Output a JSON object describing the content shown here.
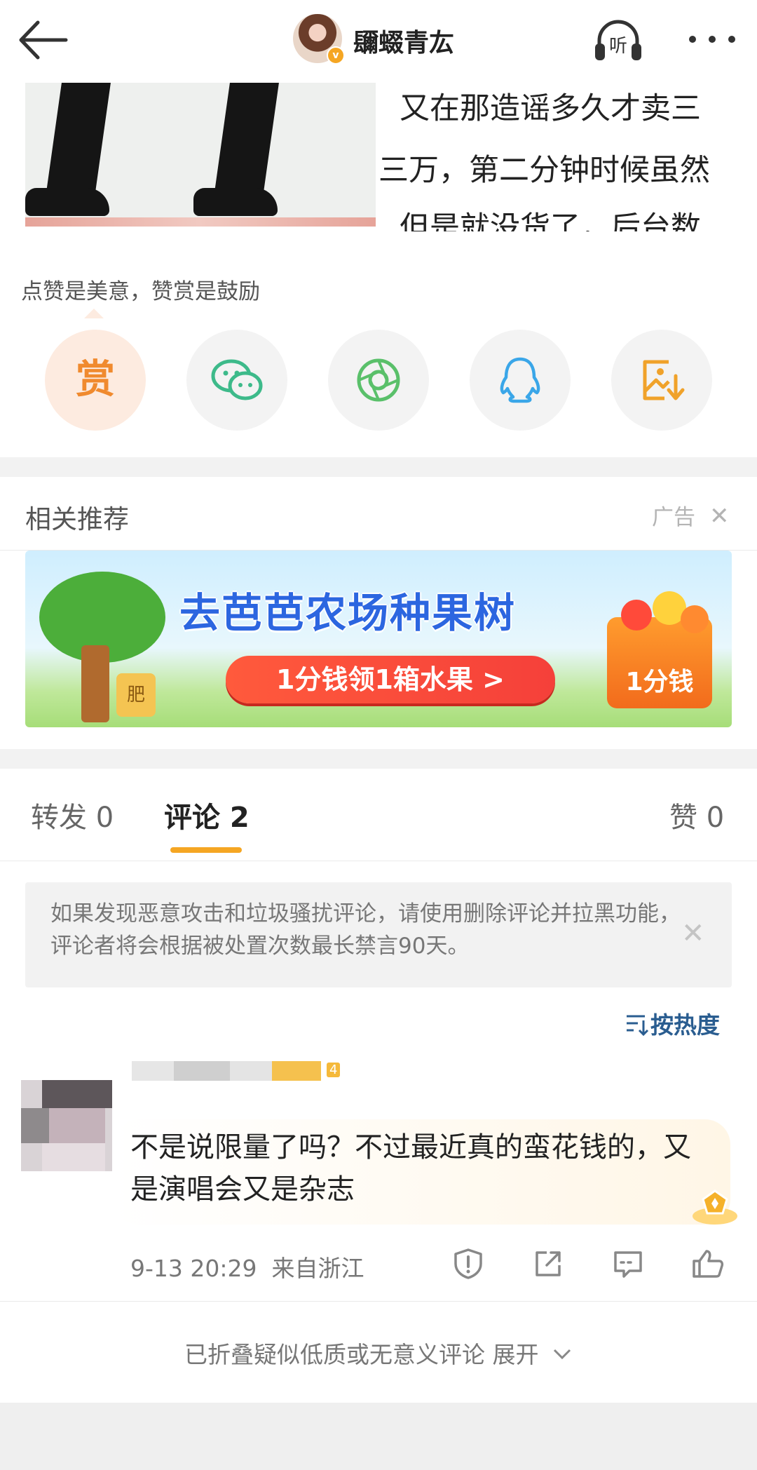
{
  "header": {
    "back_icon": "back-arrow-icon",
    "title": "镾蝃青厷",
    "listen_label": "听",
    "more_icon": "more-dots-icon"
  },
  "article": {
    "lines": [
      "又在那造谣多久才卖三",
      "三万，第二分钟时候虽然",
      "但是就没货了，后台数"
    ]
  },
  "reward": {
    "label": "点赞是美意，赞赏是鼓励",
    "reward_char": "赏",
    "share_icons": [
      "reward-icon",
      "wechat-icon",
      "moments-icon",
      "qq-icon",
      "save-image-icon"
    ]
  },
  "related": {
    "title": "相关推荐",
    "ad_label": "广告",
    "close_symbol": "✕",
    "banner": {
      "headline": "去芭芭农场种果树",
      "cta": "1分钱领1箱水果 >",
      "box_label": "1分钱",
      "fertilizer_label": "肥"
    }
  },
  "tabs": {
    "repost": "转发 0",
    "comment": "评论 2",
    "like": "赞 0"
  },
  "notice": {
    "text": "如果发现恶意攻击和垃圾骚扰评论，请使用删除评论并拉黑功能，评论者将会根据被处置次数最长禁言90天。",
    "close_symbol": "✕"
  },
  "sort": {
    "label": "按热度"
  },
  "comment": {
    "text": "不是说限量了吗？不过最近真的蛮花钱的，又是演唱会又是杂志",
    "level": "4",
    "time": "9-13 20:29",
    "location": "来自浙江",
    "actions": [
      "report-icon",
      "share-icon",
      "reply-icon",
      "like-icon"
    ]
  },
  "folded": {
    "label": "已折叠疑似低质或无意义评论 展开"
  },
  "colors": {
    "accent": "#f5a623",
    "link": "#2a5d90",
    "reward_bg": "#fdebe0"
  }
}
